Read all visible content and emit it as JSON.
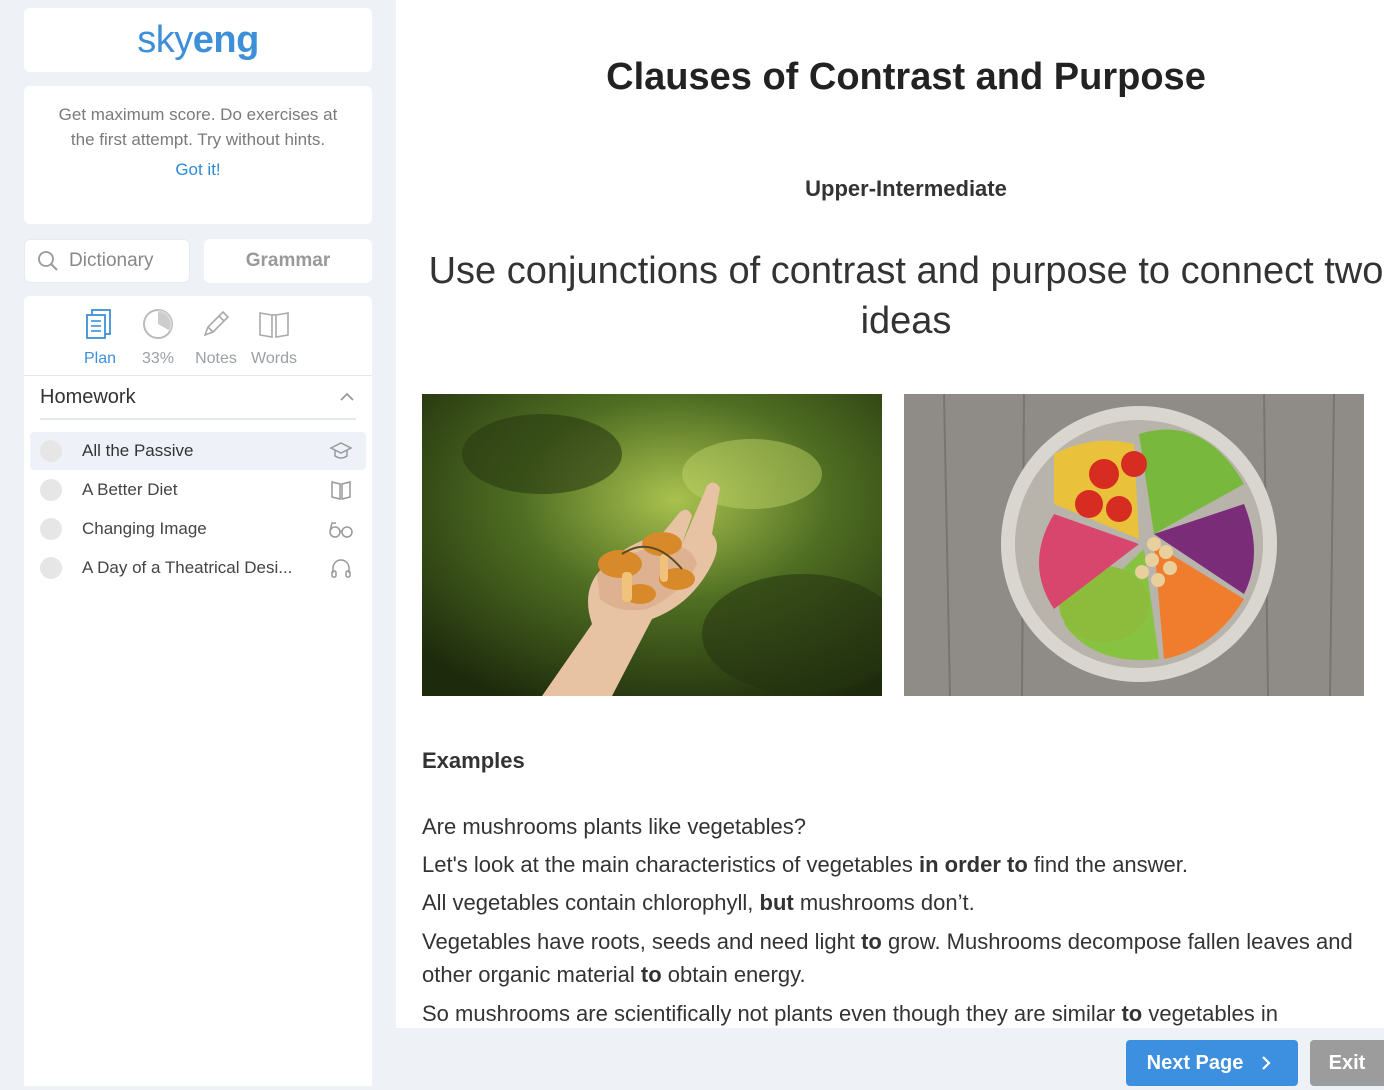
{
  "logo": {
    "part1": "sky",
    "part2": "eng"
  },
  "tip": {
    "text": "Get maximum score. Do exercises at the first attempt. Try without hints.",
    "action": "Got it!"
  },
  "search": {
    "dictionary_label": "Dictionary",
    "grammar_label": "Grammar"
  },
  "tools": [
    {
      "label": "Plan",
      "icon": "plan-icon",
      "active": true
    },
    {
      "label": "33%",
      "icon": "progress-ring-icon",
      "progress": 0.33
    },
    {
      "label": "Notes",
      "icon": "pencil-icon"
    },
    {
      "label": "Words",
      "icon": "book-icon"
    }
  ],
  "homework": {
    "title": "Homework",
    "items": [
      {
        "label": "All the Passive",
        "icon": "graduation-cap-icon",
        "active": true
      },
      {
        "label": "A Better Diet",
        "icon": "book-icon"
      },
      {
        "label": "Changing Image",
        "icon": "glasses-icon"
      },
      {
        "label": "A Day of a Theatrical Desi...",
        "icon": "headphones-icon"
      }
    ]
  },
  "lesson": {
    "title": "Clauses of Contrast and Purpose",
    "level": "Upper-Intermediate",
    "subtitle": "Use conjunctions of contrast and purpose to connect two ideas",
    "examples_heading": "Examples",
    "examples": [
      {
        "parts": [
          {
            "t": "Are mushrooms plants like vegetables?"
          }
        ]
      },
      {
        "parts": [
          {
            "t": "Let's look at the main characteristics of vegetables "
          },
          {
            "t": "in order to",
            "b": true
          },
          {
            "t": " find the answer."
          }
        ]
      },
      {
        "parts": [
          {
            "t": "All vegetables contain chlorophyll, "
          },
          {
            "t": "but",
            "b": true
          },
          {
            "t": " mushrooms don’t."
          }
        ]
      },
      {
        "parts": [
          {
            "t": "Vegetables have roots, seeds and need light "
          },
          {
            "t": "to",
            "b": true
          },
          {
            "t": " grow. Mushrooms decompose fallen leaves and other organic material "
          },
          {
            "t": "to",
            "b": true
          },
          {
            "t": " obtain energy."
          }
        ]
      },
      {
        "parts": [
          {
            "t": "So mushrooms are scientifically not plants even though they are similar "
          },
          {
            "t": "to",
            "b": true
          },
          {
            "t": " vegetables in"
          }
        ]
      }
    ]
  },
  "footer": {
    "next_label": "Next Page",
    "exit_label": "Exit"
  },
  "colors": {
    "accent": "#3d8fe0",
    "brand": "#3e8fd9",
    "exit": "#9c9c9c"
  }
}
